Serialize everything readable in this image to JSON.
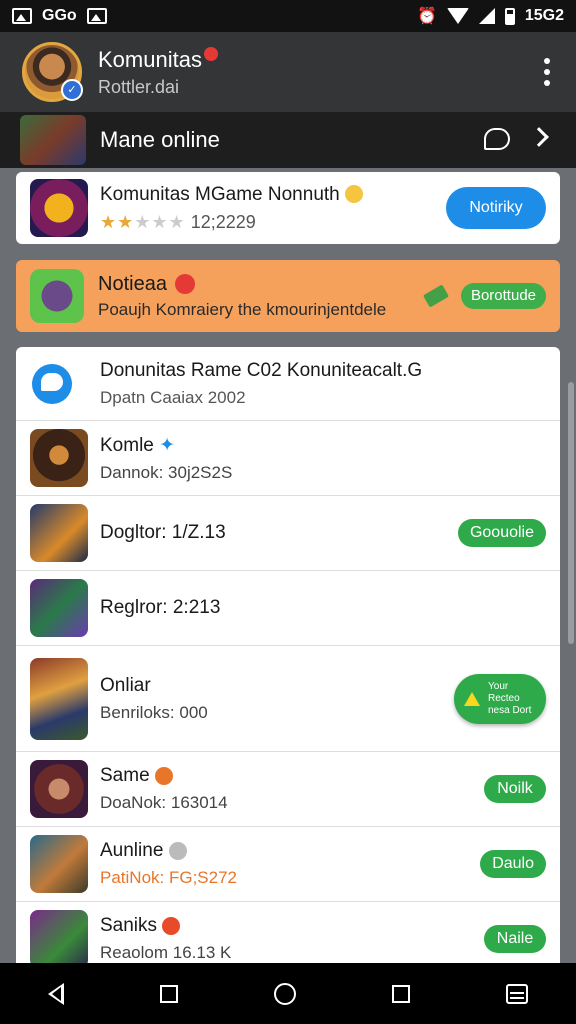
{
  "status_bar": {
    "left_text": "GGo",
    "time": "15G2"
  },
  "header": {
    "title": "Komunitas",
    "subtitle": "Rottler.dai"
  },
  "section": {
    "title": "Mane online"
  },
  "featured": {
    "title": "Komunitas MGame Nonnuth",
    "rating_text": "12;2229",
    "stars_on": 2,
    "button_label": "Notiriky"
  },
  "promo": {
    "title": "Notieaa",
    "subtitle": "Poaujh Komraiery the kmourinjentdele",
    "button_label": "Borottude"
  },
  "list": {
    "header_title": "Donunitas Rame C02 Konuniteacalt.G",
    "header_sub": "Dpatn Caaiax 2002",
    "rows": [
      {
        "title": "Komle",
        "sub": "Dannok: 30j2S2S",
        "button": ""
      },
      {
        "title": "Dogltor: 1/Z.13",
        "sub": "",
        "button": "Goouolie"
      },
      {
        "title": "Reglror: 2:213",
        "sub": "",
        "button": ""
      },
      {
        "title": "Onliar",
        "sub": "Benriloks: 000",
        "button": ""
      },
      {
        "title": "Same",
        "sub": "DoaNok: 163014",
        "button": "Noilk"
      },
      {
        "title": "Aunline",
        "sub": "PatiNok: FG;S272",
        "button": "Daulo"
      },
      {
        "title": "Saniks",
        "sub": "Reaolom 16.13 K",
        "button": "Naile"
      }
    ],
    "fab_label": "Your Recteo nesa Dort"
  },
  "colors": {
    "accent_blue": "#1e8de8",
    "accent_green": "#2faa4a",
    "promo_orange": "#f5a15c",
    "header_dark": "#333537"
  }
}
